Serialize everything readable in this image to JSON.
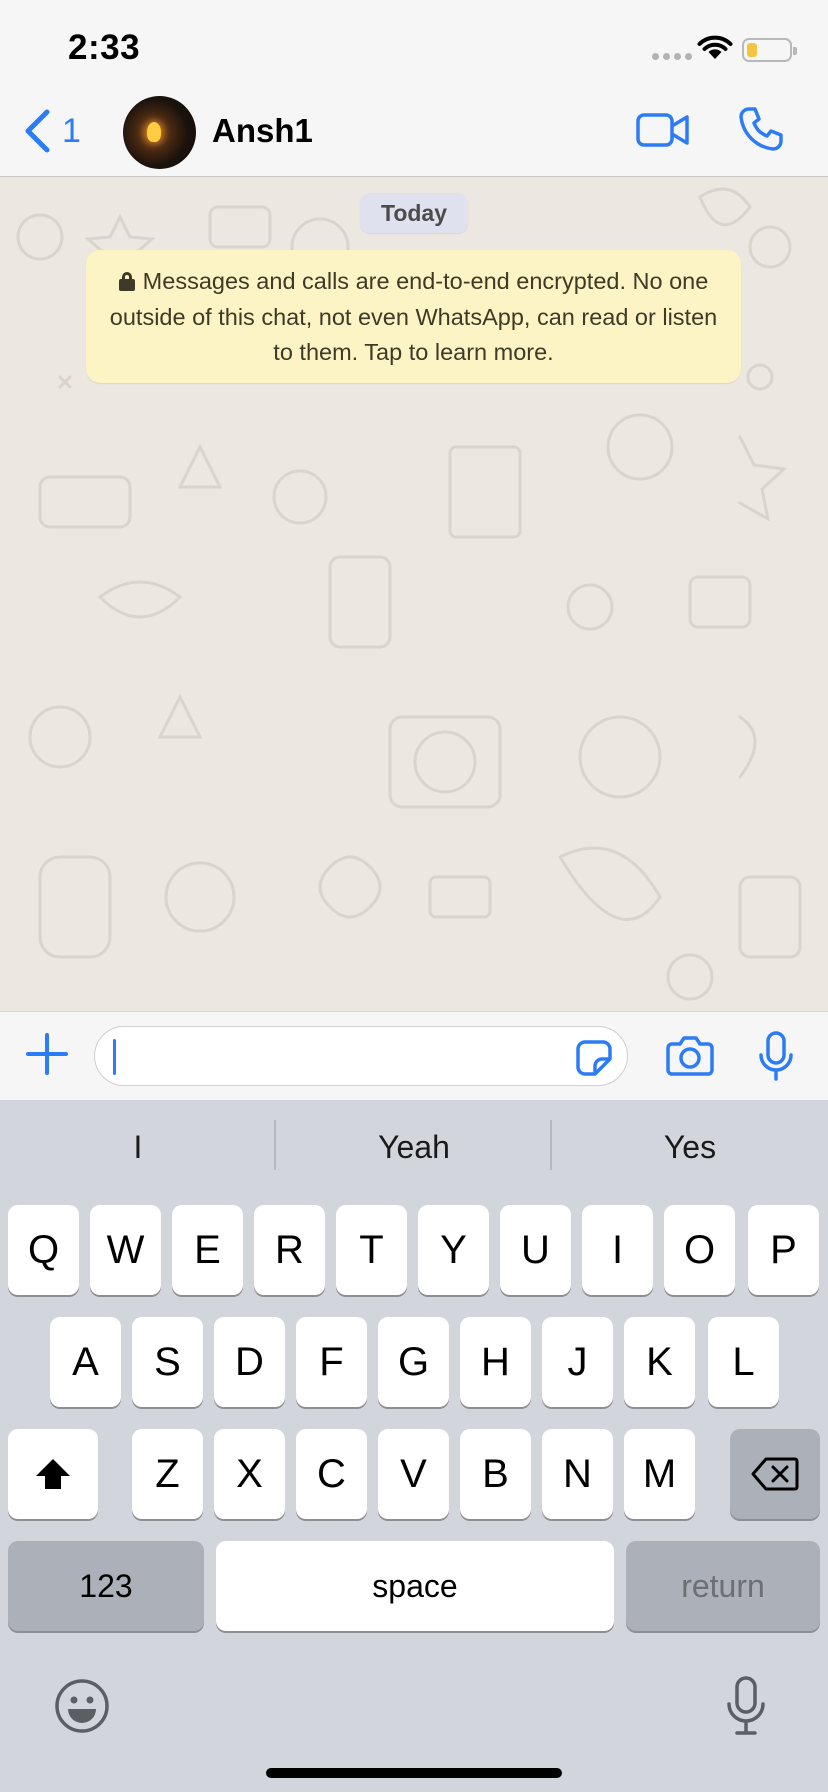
{
  "status_bar": {
    "time": "2:33"
  },
  "header": {
    "back_count": "1",
    "contact_name": "Ansh1"
  },
  "chat": {
    "date_chip": "Today",
    "encryption_notice": "Messages and calls are end-to-end encrypted. No one outside of this chat, not even WhatsApp, can read or listen to them. Tap to learn more."
  },
  "input": {
    "value": "",
    "placeholder": ""
  },
  "keyboard": {
    "suggestions": [
      "I",
      "Yeah",
      "Yes"
    ],
    "row1": [
      "Q",
      "W",
      "E",
      "R",
      "T",
      "Y",
      "U",
      "I",
      "O",
      "P"
    ],
    "row2": [
      "A",
      "S",
      "D",
      "F",
      "G",
      "H",
      "J",
      "K",
      "L"
    ],
    "row3": [
      "Z",
      "X",
      "C",
      "V",
      "B",
      "N",
      "M"
    ],
    "numbers_label": "123",
    "space_label": "space",
    "return_label": "return"
  },
  "colors": {
    "accent": "#2c7cf6",
    "notice_bg": "#fcf4c4",
    "chat_bg": "#ece8e1",
    "keyboard_bg": "#d2d5db"
  },
  "icons": [
    "chevron-left-icon",
    "video-camera-icon",
    "phone-icon",
    "plus-icon",
    "sticker-icon",
    "camera-icon",
    "microphone-icon",
    "lock-icon",
    "shift-icon",
    "backspace-icon",
    "emoji-icon",
    "wifi-icon",
    "battery-icon"
  ]
}
